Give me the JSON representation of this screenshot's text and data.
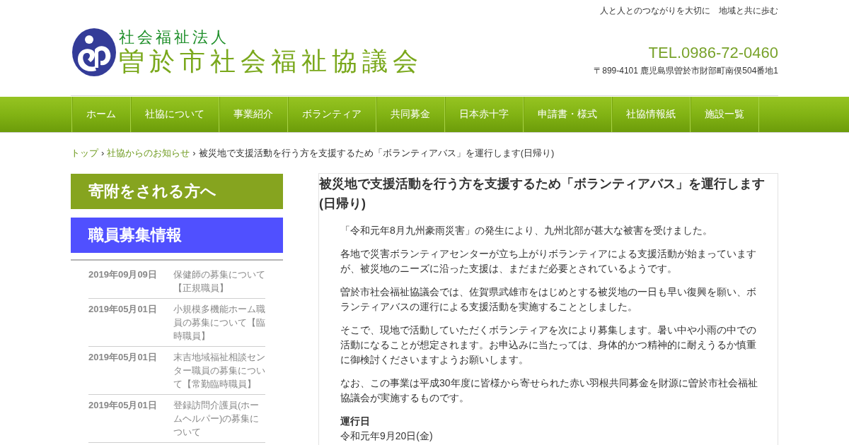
{
  "header": {
    "tagline": "人と人とのつながりを大切に　地域と共に歩む",
    "logo": {
      "subtitle": "社会福祉法人",
      "name": "曽於市社会福祉協議会"
    },
    "phone": "TEL.0986-72-0460",
    "address": "〒899-4101 鹿児島県曽於市財部町南俣504番地1"
  },
  "nav": {
    "items": [
      "ホーム",
      "社協について",
      "事業紹介",
      "ボランティア",
      "共同募金",
      "日本赤十字",
      "申請書・様式",
      "社協情報紙",
      "施設一覧"
    ]
  },
  "breadcrumb": [
    {
      "kind": "link",
      "label": "トップ"
    },
    {
      "kind": "separator",
      "label": "›"
    },
    {
      "kind": "link",
      "label": "社協からのお知らせ"
    },
    {
      "kind": "separator",
      "label": "›"
    },
    {
      "kind": "current",
      "label": "被災地で支援活動を行う方を支援するため「ボランティアバス」を運行します(日帰り)"
    }
  ],
  "sidebar": {
    "banners": [
      {
        "label": "寄附をされる方へ",
        "color": "#86a41f"
      },
      {
        "label": "職員募集情報",
        "color": "#5050ff"
      }
    ],
    "job_posts": [
      {
        "date": "2019年09月09日",
        "title": "保健師の募集について【正規職員】"
      },
      {
        "date": "2019年05月01日",
        "title": "小規模多機能ホーム職員の募集について【臨時職員】"
      },
      {
        "date": "2019年05月01日",
        "title": "末吉地域福祉相談センター職員の募集について【常勤臨時職員】"
      },
      {
        "date": "2019年05月01日",
        "title": "登録訪問介護員(ホームヘルパー)の募集について"
      }
    ]
  },
  "article": {
    "title": "被災地で支援活動を行う方を支援するため「ボランティアバス」を運行します(日帰り)",
    "body": [
      {
        "kind": "paragraph",
        "text": "「令和元年8月九州豪雨災害」の発生により、九州北部が甚大な被害を受けました。"
      },
      {
        "kind": "paragraph",
        "text": "各地で災害ボランティアセンターが立ち上がりボランティアによる支援活動が始まっていますが、被災地のニーズに沿った支援は、まだまだ必要とされているようです。"
      },
      {
        "kind": "paragraph",
        "text": "曽於市社会福祉協議会では、佐賀県武雄市をはじめとする被災地の一日も早い復興を願い、ボランティアバスの運行による支援活動を実施することとしました。"
      },
      {
        "kind": "paragraph",
        "text": "そこで、現地で活動していただくボランティアを次により募集します。暑い中や小雨の中での活動になることが想定されます。お申込みに当たっては、身体的かつ精神的に耐えうるか慎重に御検討くださいますようお願いします。"
      },
      {
        "kind": "paragraph",
        "text": "なお、この事業は平成30年度に皆様から寄せられた赤い羽根共同募金を財源に曽於市社会福祉協議会が実施するものです。"
      },
      {
        "kind": "heading",
        "text": "運行日"
      },
      {
        "kind": "line",
        "text": "令和元年9月20日(金)"
      }
    ]
  }
}
